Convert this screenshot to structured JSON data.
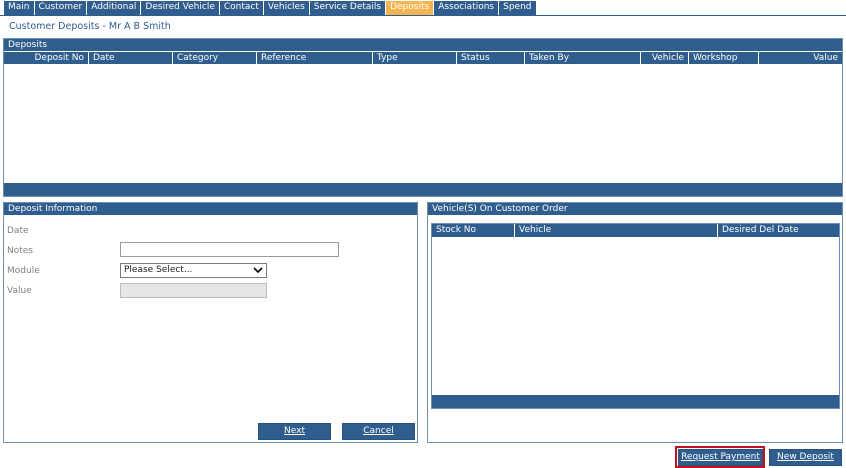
{
  "tabs": [
    {
      "label": "Main",
      "active": false
    },
    {
      "label": "Customer",
      "active": false
    },
    {
      "label": "Additional",
      "active": false
    },
    {
      "label": "Desired Vehicle",
      "active": false
    },
    {
      "label": "Contact",
      "active": false
    },
    {
      "label": "Vehicles",
      "active": false
    },
    {
      "label": "Service Details",
      "active": false
    },
    {
      "label": "Deposits",
      "active": true
    },
    {
      "label": "Associations",
      "active": false
    },
    {
      "label": "Spend",
      "active": false
    }
  ],
  "page_title": "Customer Deposits - Mr A B Smith",
  "deposits": {
    "title": "Deposits",
    "columns": [
      "Deposit No",
      "Date",
      "Category",
      "Reference",
      "Type",
      "Status",
      "Taken By",
      "Vehicle",
      "Workshop",
      "Value"
    ]
  },
  "deposit_info": {
    "title": "Deposit Information",
    "date_label": "Date",
    "notes_label": "Notes",
    "notes_value": "",
    "module_label": "Module",
    "module_selected": "Please Select...",
    "value_label": "Value",
    "next_label": "Next",
    "cancel_label": "Cancel"
  },
  "vehicles": {
    "title": "Vehicle(S) On Customer Order",
    "columns": [
      "Stock No",
      "Vehicle",
      "Desired Del Date"
    ]
  },
  "actions": {
    "request_payment": "Request Payment",
    "new_deposit": "New Deposit"
  },
  "colors": {
    "header_blue": "#2f5e8e",
    "active_tab": "#f3b451",
    "highlight_red": "#c4121f"
  }
}
